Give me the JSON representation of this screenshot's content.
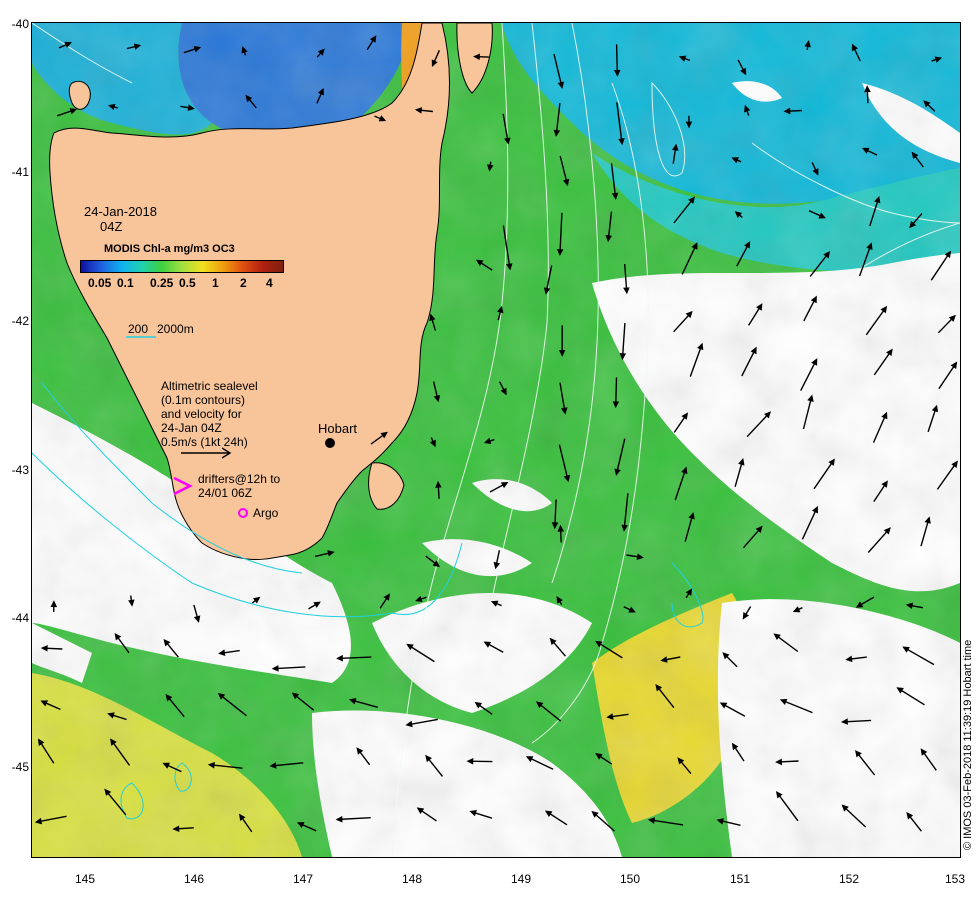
{
  "map": {
    "date": "24-Jan-2018",
    "time": "04Z",
    "product": "MODIS Chl-a mg/m3 OC3",
    "colorbar_ticks": [
      "0.05",
      "0.1",
      "0.25",
      "0.5",
      "1",
      "2",
      "4"
    ],
    "depth_legend_a": "200",
    "depth_legend_b": "2000m",
    "altimetry_note": "Altimetric sealevel\n(0.1m contours)\nand velocity for\n24-Jan 04Z\n0.5m/s (1kt 24h)",
    "drifters_note": "drifters@12h to\n24/01 06Z",
    "argo_label": "Argo",
    "place_label": "Hobart",
    "credit": "© IMOS 03-Feb-2018 11:39:19 Hobart time",
    "lat_ticks": [
      "-40",
      "-41",
      "-42",
      "-43",
      "-44",
      "-45"
    ],
    "lon_ticks": [
      "145",
      "146",
      "147",
      "148",
      "149",
      "150",
      "151",
      "152",
      "153"
    ],
    "lat_range": [
      -45.6,
      -40
    ],
    "lon_range": [
      144.5,
      153
    ],
    "colors": {
      "land": "#f8c49a",
      "cloud": "#ffffff",
      "chl_low": "#00a0e0",
      "chl_mid": "#30c040",
      "chl_high": "#f0d020",
      "contour": "#ffffff",
      "isobath": "#20d0e0",
      "drifter": "#ff00ff",
      "argo": "#ff00ff"
    }
  }
}
